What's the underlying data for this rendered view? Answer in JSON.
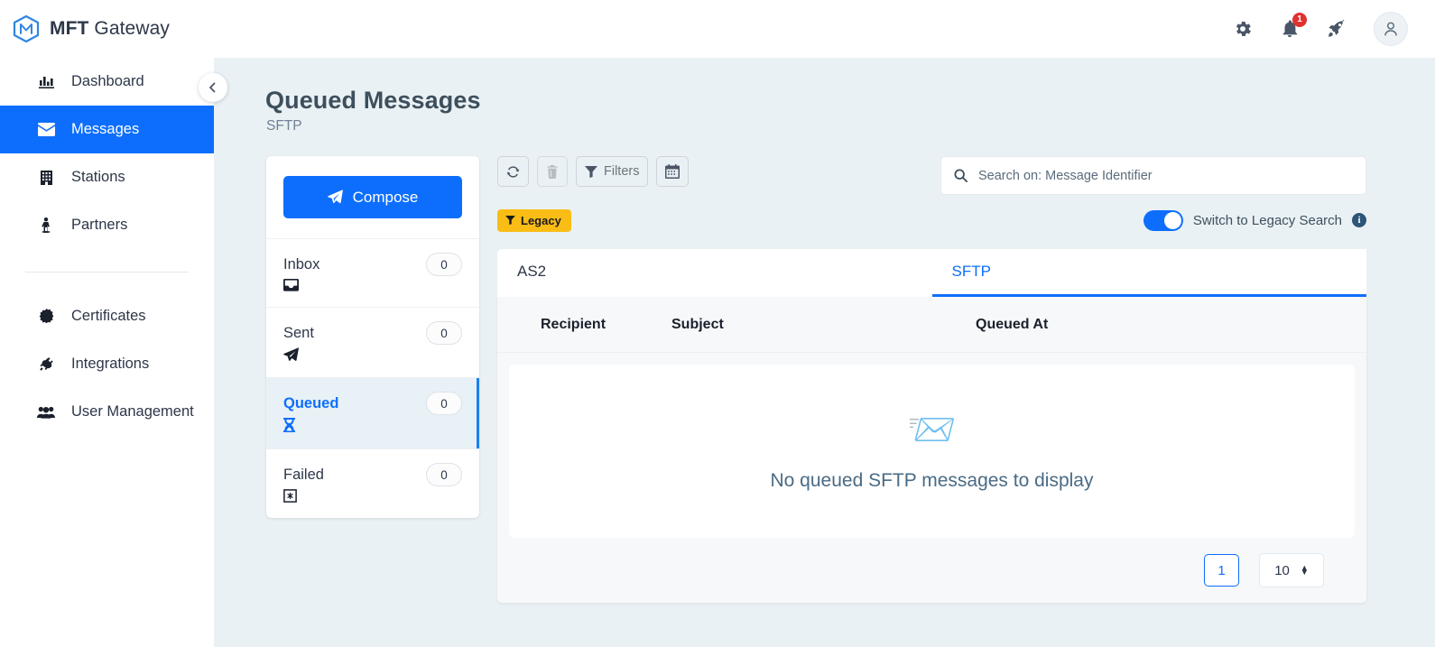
{
  "brand": {
    "name_bold": "MFT",
    "name_light": " Gateway",
    "logo_icon": "cube-logo-icon"
  },
  "topbar": {
    "icons": [
      {
        "name": "settings-gear-icon",
        "label": "gear-icon"
      },
      {
        "name": "notifications-bell-icon",
        "label": "bell-icon",
        "badge": "1"
      },
      {
        "name": "rocket-icon",
        "label": "rocket-icon"
      },
      {
        "name": "user-avatar",
        "label": "user-icon"
      }
    ]
  },
  "sidebar": {
    "collapse_icon": "‹",
    "items": [
      {
        "label": "Dashboard",
        "icon": "📊",
        "icon_name": "chart-bar-icon",
        "active": false
      },
      {
        "label": "Messages",
        "icon": "✉",
        "icon_name": "envelope-icon",
        "active": true
      },
      {
        "label": "Stations",
        "icon": "🏢",
        "icon_name": "building-icon",
        "active": false
      },
      {
        "label": "Partners",
        "icon": "🚶",
        "icon_name": "person-icon",
        "active": false
      },
      {
        "label": "Certificates",
        "icon": "✵",
        "icon_name": "certificate-icon",
        "active": false
      },
      {
        "label": "Integrations",
        "icon": "🔌",
        "icon_name": "plug-icon",
        "active": false
      },
      {
        "label": "User Management",
        "icon": "👥",
        "icon_name": "users-icon",
        "active": false
      }
    ]
  },
  "page": {
    "title": "Queued Messages",
    "subtitle": "SFTP"
  },
  "folders": {
    "compose_label": "Compose",
    "compose_icon": "send-plane-icon",
    "items": [
      {
        "label": "Inbox",
        "count": "0",
        "icon": "📥",
        "icon_name": "inbox-tray-icon",
        "active": false
      },
      {
        "label": "Sent",
        "count": "0",
        "icon": "➤",
        "icon_name": "paper-plane-icon",
        "active": false
      },
      {
        "label": "Queued",
        "count": "0",
        "icon": "⌛",
        "icon_name": "hourglass-icon",
        "active": true
      },
      {
        "label": "Failed",
        "count": "0",
        "icon": "⌧",
        "icon_name": "failed-box-icon",
        "active": false
      }
    ]
  },
  "toolbar": {
    "refresh_title": "refresh-icon",
    "delete_title": "trash-icon",
    "filters_label": "Filters",
    "filters_icon": "funnel-icon",
    "calendar_title": "calendar-icon",
    "legacy_badge": "Legacy",
    "legacy_badge_icon": "funnel-icon"
  },
  "search": {
    "placeholder": "Search on: Message Identifier",
    "value": "",
    "icon": "search-icon"
  },
  "legacy_toggle": {
    "label": "Switch to Legacy Search",
    "state": "on",
    "info_icon": "info-icon",
    "info_char": "i"
  },
  "tabs": [
    {
      "label": "AS2",
      "active": false
    },
    {
      "label": "SFTP",
      "active": true
    }
  ],
  "table": {
    "columns": [
      "Recipient",
      "Subject",
      "Queued At"
    ],
    "rows": [],
    "empty_text": "No queued SFTP messages to display",
    "empty_icon": "📨",
    "empty_icon_name": "open-envelope-icon"
  },
  "pagination": {
    "current_page": "1",
    "page_size": "10"
  },
  "colors": {
    "accent_blue": "#0d6efd",
    "legacy_yellow": "#f9bd16",
    "badge_red": "#e03131",
    "page_bg": "#eaf1f4",
    "empty_text": "#4a6b85"
  }
}
